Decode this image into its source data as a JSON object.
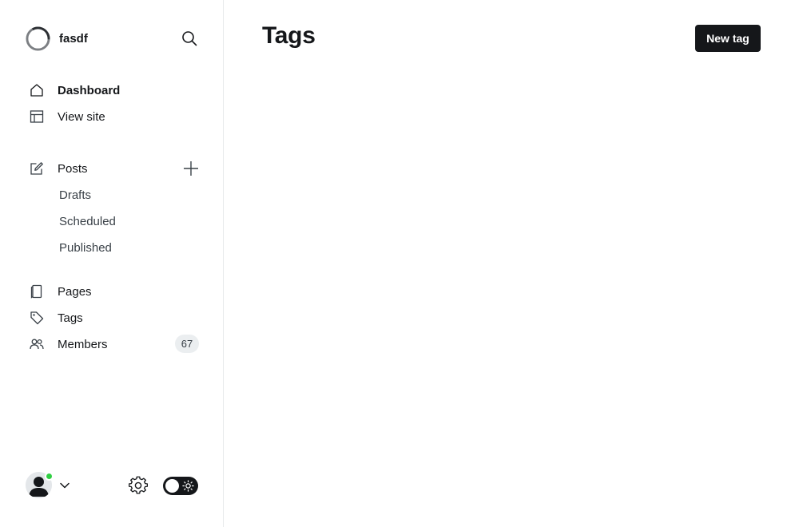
{
  "site": {
    "name": "fasdf"
  },
  "sidebar": {
    "search_icon": "search-icon",
    "nav": {
      "dashboard": {
        "label": "Dashboard",
        "icon": "home-icon"
      },
      "view_site": {
        "label": "View site",
        "icon": "layout-icon"
      },
      "posts": {
        "label": "Posts",
        "icon": "edit-icon"
      },
      "drafts": {
        "label": "Drafts"
      },
      "scheduled": {
        "label": "Scheduled"
      },
      "published": {
        "label": "Published"
      },
      "pages": {
        "label": "Pages",
        "icon": "page-icon"
      },
      "tags": {
        "label": "Tags",
        "icon": "tag-icon"
      },
      "members": {
        "label": "Members",
        "icon": "members-icon",
        "count": "67"
      }
    },
    "footer": {
      "user_status": "online",
      "status_color": "#30cf43",
      "theme_toggle": "dark-mode-toggle"
    }
  },
  "main": {
    "title": "Tags",
    "new_button": "New tag"
  },
  "colors": {
    "primary_text": "#15171a",
    "button_bg": "#15171a",
    "border": "#e6e9eb",
    "badge_bg": "#ebeef0"
  }
}
